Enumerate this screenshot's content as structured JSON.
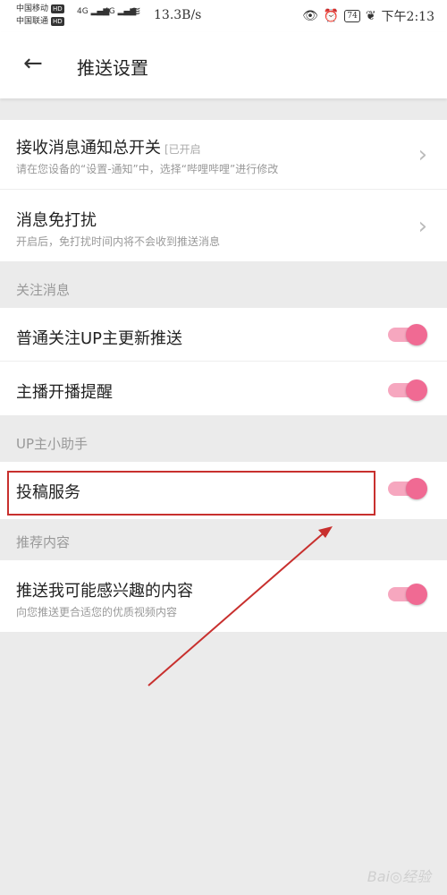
{
  "status_bar": {
    "carrier1": "中国移动",
    "carrier2": "中国联通",
    "hd": "HD",
    "net": "4G",
    "speed": "13.3B/s",
    "battery": "74",
    "time": "下午2:13"
  },
  "header": {
    "back_icon": "arrow-left-icon",
    "title": "推送设置"
  },
  "rows": {
    "master_switch": {
      "label": "接收消息通知总开关",
      "badge": "[已开启",
      "desc": "请在您设备的“设置-通知”中，选择“哔哩哔哩”进行修改"
    },
    "dnd": {
      "label": "消息免打扰",
      "desc": "开启后，免打扰时间内将不会收到推送消息"
    }
  },
  "sections": {
    "follow": "关注消息",
    "up_helper": "UP主小助手",
    "recommend": "推荐内容"
  },
  "toggles": {
    "follow_up": {
      "label": "普通关注UP主更新推送",
      "on": true
    },
    "live_alert": {
      "label": "主播开播提醒",
      "on": true
    },
    "submission": {
      "label": "投稿服务",
      "on": true
    },
    "interest": {
      "label": "推送我可能感兴趣的内容",
      "desc": "向您推送更合适您的优质视频内容",
      "on": true
    }
  },
  "colors": {
    "accent": "#f06a93",
    "accent_track": "#f6a7bf",
    "annotation": "#c8302e"
  },
  "watermark": "Bai◎经验"
}
